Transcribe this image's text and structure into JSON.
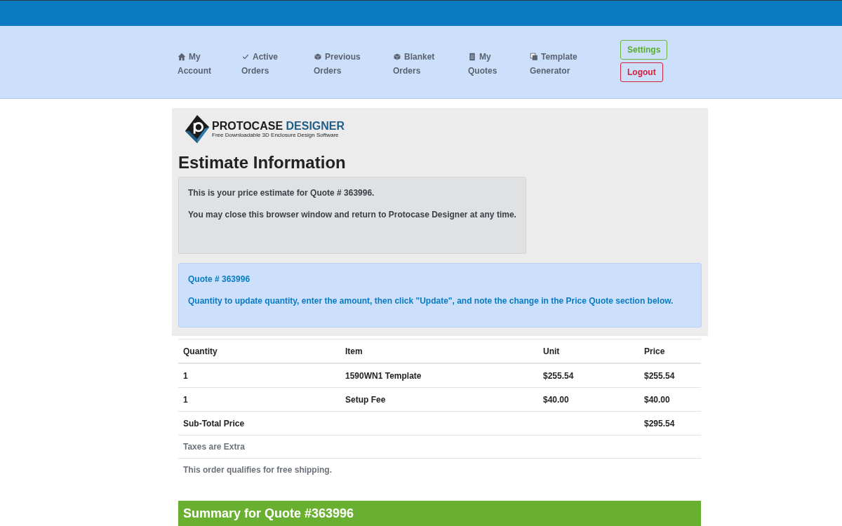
{
  "nav": {
    "items": [
      {
        "kind": "home",
        "label": "My Account"
      },
      {
        "kind": "check",
        "label": "Active Orders"
      },
      {
        "kind": "box",
        "label": "Previous Orders"
      },
      {
        "kind": "box",
        "label": "Blanket Orders"
      },
      {
        "kind": "doc",
        "label": "My Quotes"
      },
      {
        "kind": "copy",
        "label": "Template Generator"
      }
    ],
    "buttons": [
      {
        "kind": "settings",
        "label": "Settings"
      },
      {
        "kind": "logout",
        "label": "Logout"
      }
    ]
  },
  "logo": {
    "name_dark": "PROTOCASE",
    "name_accent": "DESIGNER",
    "tagline": "Free Downloadable 3D Enclosure Design Software"
  },
  "title": "Estimate Information",
  "info_box": [
    "This is your price estimate for Quote # 363996.",
    "You may close this browser window and return to Protocase Designer at any time."
  ],
  "quote_box": {
    "heading": "Quote # 363996",
    "text": "Quantity to update quantity, enter the amount, then click \"Update\", and note the change in the Price Quote section below."
  },
  "table": {
    "columns": [
      "Quantity",
      "Item",
      "Unit",
      "Price"
    ],
    "rows": [
      {
        "cells": [
          "1",
          "1590WN1 Template",
          "$255.54",
          "$255.54"
        ]
      },
      {
        "cells": [
          "1",
          "Setup Fee",
          "$40.00",
          "$40.00"
        ]
      },
      {
        "cells": [
          "Sub-Total Price",
          "",
          "",
          "$295.54"
        ]
      }
    ]
  },
  "notes": [
    "Taxes are Extra",
    "This order qualifies for free shipping."
  ],
  "summary": {
    "title": "Summary for Quote #363996"
  }
}
